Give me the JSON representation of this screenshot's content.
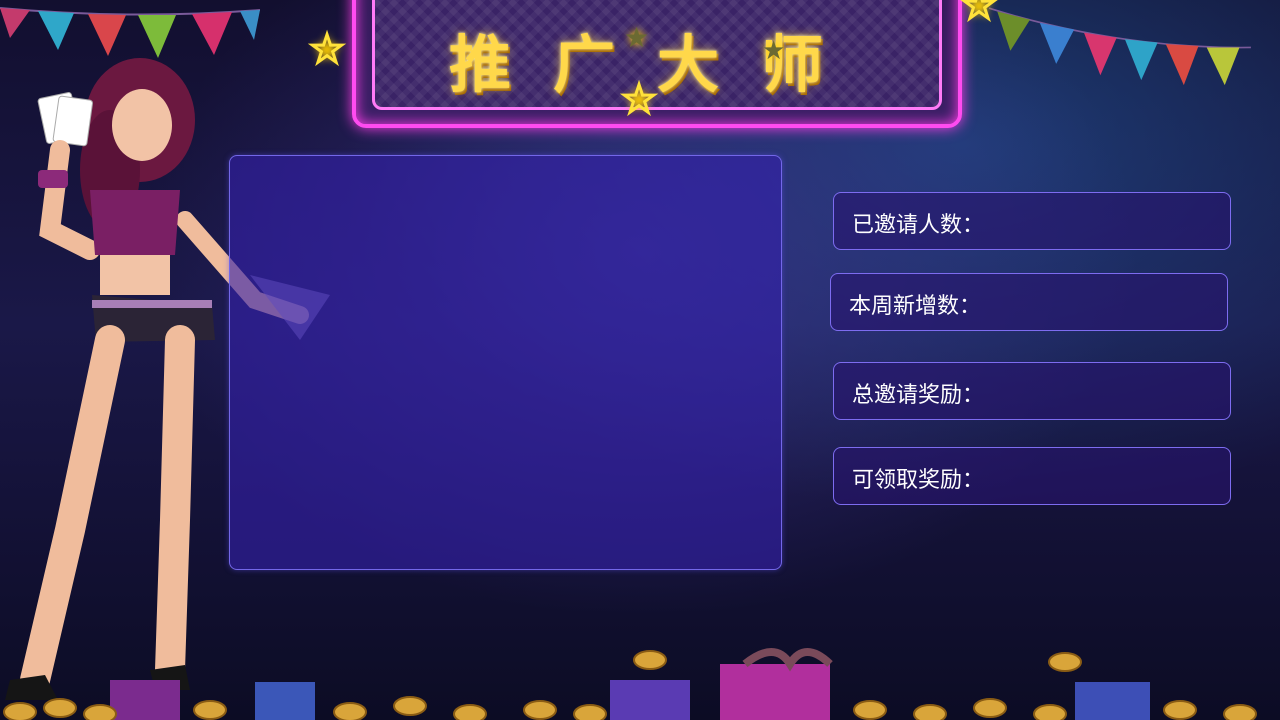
{
  "title": "推广大师",
  "stats": [
    {
      "label": "已邀请人数："
    },
    {
      "label": "本周新增数："
    },
    {
      "label": "总邀请奖励："
    },
    {
      "label": "可领取奖励："
    }
  ],
  "colors": {
    "neon": "#ff4bf0",
    "title_gold": "#ffd84a",
    "panel": "#3420aa",
    "stat_border": "#7d6cf0"
  }
}
